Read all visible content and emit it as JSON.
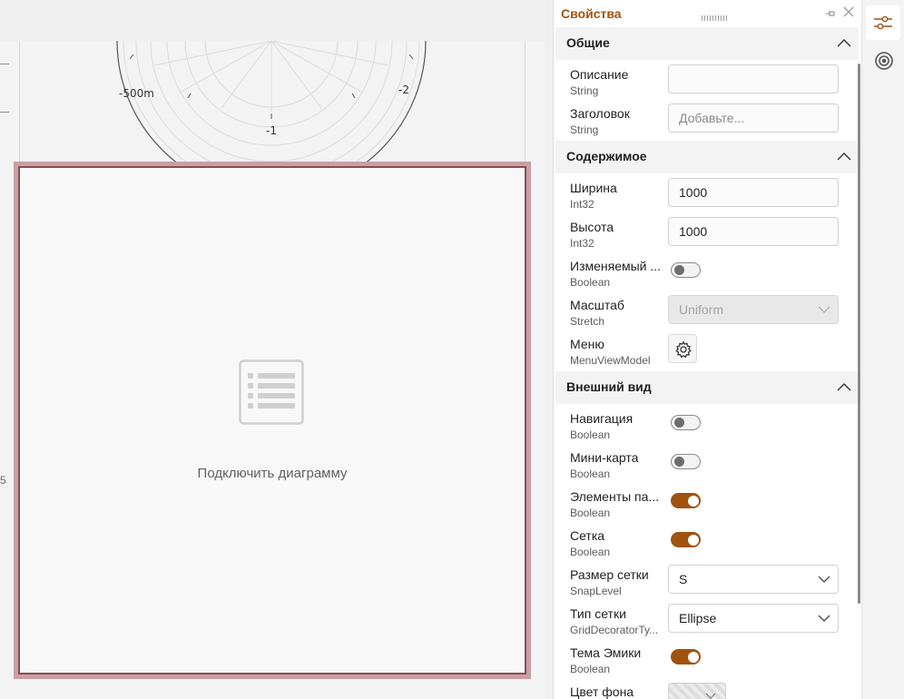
{
  "canvas": {
    "chart": {
      "tick_labels": [
        "-500m",
        "-2",
        "-1"
      ]
    },
    "edge_glyph": "5",
    "placeholder": {
      "icon": "list-icon",
      "label": "Подключить диаграмму"
    }
  },
  "panel": {
    "title": "Свойства",
    "sections": {
      "general": {
        "title": "Общие",
        "props": {
          "description": {
            "name": "Описание",
            "type": "String",
            "value": ""
          },
          "header": {
            "name": "Заголовок",
            "type": "String",
            "placeholder": "Добавьте..."
          }
        }
      },
      "content": {
        "title": "Содержимое",
        "props": {
          "width": {
            "name": "Ширина",
            "type": "Int32",
            "value": "1000"
          },
          "height": {
            "name": "Высота",
            "type": "Int32",
            "value": "1000"
          },
          "resizable": {
            "name": "Изменяемый ...",
            "type": "Boolean",
            "checked": false
          },
          "scale": {
            "name": "Масштаб",
            "type": "Stretch",
            "value": "Uniform",
            "disabled": true
          },
          "menu": {
            "name": "Меню",
            "type": "MenuViewModel",
            "icon": "gear-icon"
          }
        }
      },
      "appearance": {
        "title": "Внешний вид",
        "props": {
          "navigation": {
            "name": "Навигация",
            "type": "Boolean",
            "checked": false
          },
          "minimap": {
            "name": "Мини-карта",
            "type": "Boolean",
            "checked": false
          },
          "elements": {
            "name": "Элементы па...",
            "type": "Boolean",
            "checked": true
          },
          "grid": {
            "name": "Сетка",
            "type": "Boolean",
            "checked": true
          },
          "grid_size": {
            "name": "Размер сетки",
            "type": "SnapLevel",
            "value": "S"
          },
          "grid_type": {
            "name": "Тип сетки",
            "type": "GridDecoratorTy...",
            "value": "Ellipse"
          },
          "emika_theme": {
            "name": "Тема Эмики",
            "type": "Boolean",
            "checked": true
          },
          "bg_color": {
            "name": "Цвет фона"
          }
        }
      }
    }
  },
  "rail": {
    "items": [
      {
        "icon": "sliders-icon",
        "active": true
      },
      {
        "icon": "target-icon",
        "active": false
      }
    ]
  },
  "colors": {
    "accent": "#a0520f",
    "frame_outer": "#c9a0a4",
    "frame_inner": "#8c4b52"
  }
}
